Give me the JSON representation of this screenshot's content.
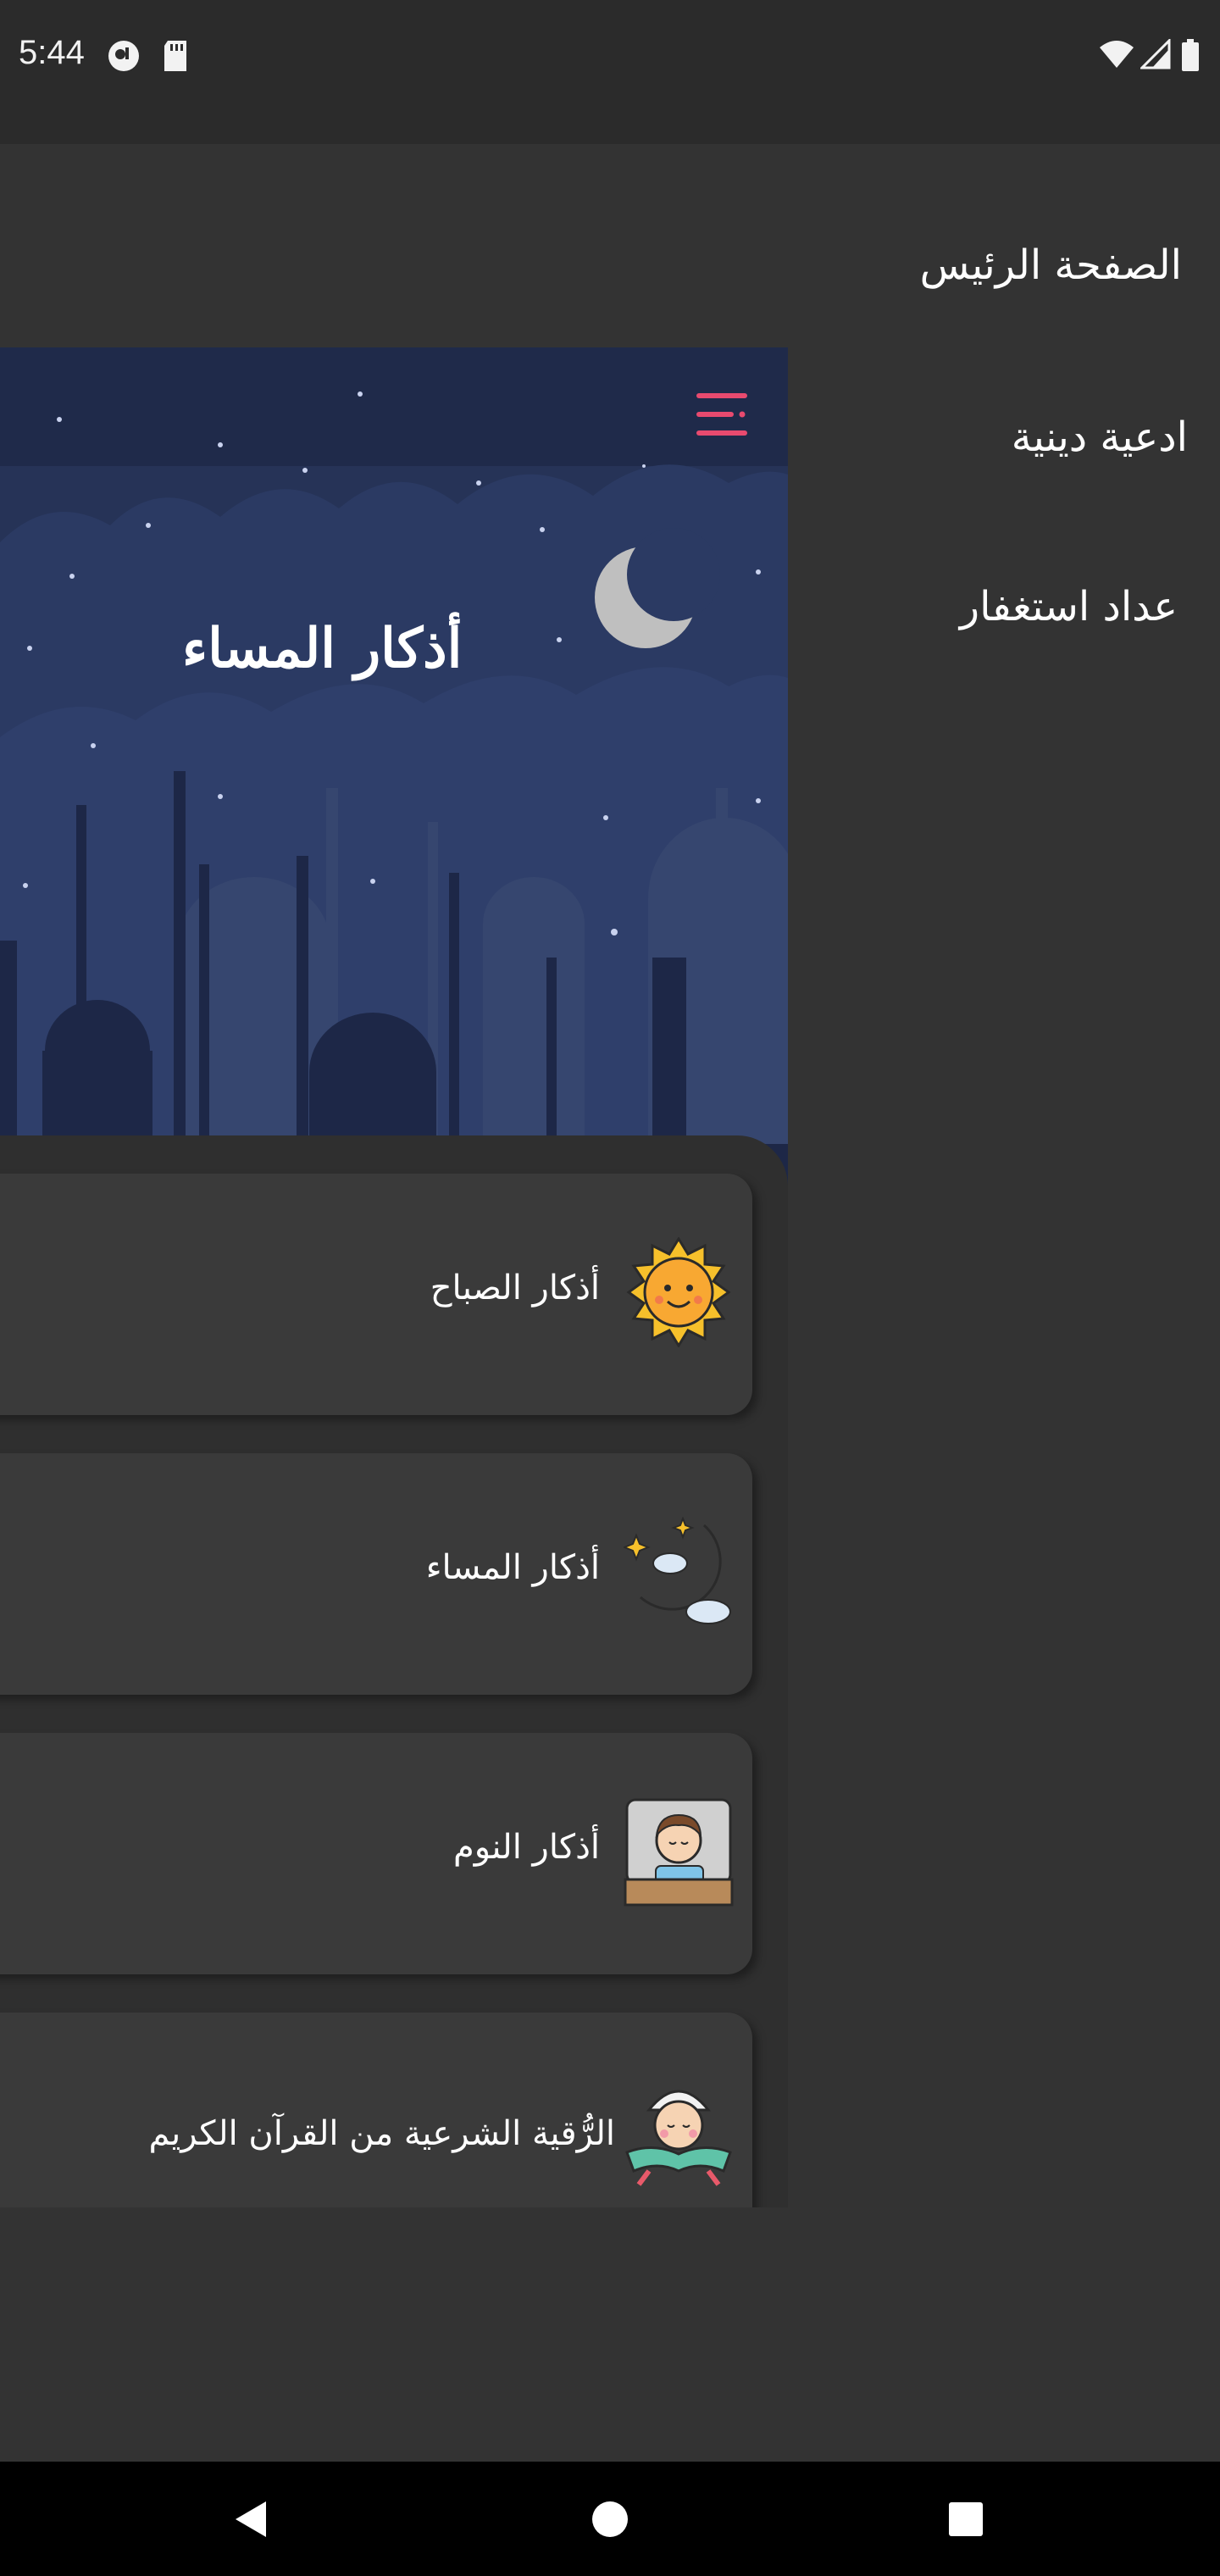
{
  "status_bar": {
    "time": "5:44"
  },
  "menu": {
    "items": [
      {
        "label": "الصفحة الرئيس"
      },
      {
        "label": "ادعية دينية"
      },
      {
        "label": "عداد استغفار"
      }
    ]
  },
  "hero": {
    "title": "أذكار المساء"
  },
  "cards": [
    {
      "label": "أذكار الصباح",
      "icon": "sun-icon"
    },
    {
      "label": "أذكار المساء",
      "icon": "moon-icon"
    },
    {
      "label": "أذكار النوم",
      "icon": "sleeping-person-icon"
    },
    {
      "label": "الرُّقية الشرعية من القرآن الكريم",
      "icon": "quran-reader-icon"
    }
  ],
  "colors": {
    "accent": "#e84a6f",
    "hero_sky": "#243056",
    "background": "#333333"
  }
}
